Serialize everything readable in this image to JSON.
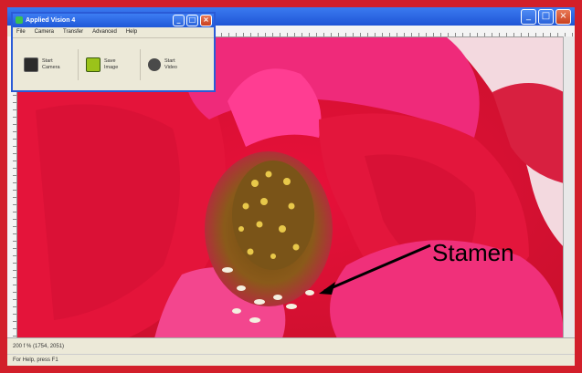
{
  "image_window": {
    "minimize": "_",
    "maximize": "□",
    "close": "×"
  },
  "app_window": {
    "title": "Applied Vision 4",
    "minimize": "_",
    "maximize": "□",
    "close": "×",
    "menu": [
      "File",
      "Camera",
      "Transfer",
      "Advanced",
      "Help"
    ],
    "toolbar": [
      {
        "label_line1": "Start",
        "label_line2": "Camera",
        "icon": "camera-icon",
        "color": "#2b2b2b"
      },
      {
        "label_line1": "Save",
        "label_line2": "Image",
        "icon": "save-image-icon",
        "color": "#9bc31a"
      },
      {
        "label_line1": "Start",
        "label_line2": "Video",
        "icon": "video-icon",
        "color": "#4a4a4a"
      }
    ]
  },
  "annotation": {
    "label": "Stamen"
  },
  "status_bar": {
    "text": "200 f %  (1754, 2051)",
    "text2": "For Help, press F1"
  },
  "colors": {
    "frame": "#d21f2a",
    "petal_red": "#e0203a",
    "petal_pink": "#f0307a",
    "xp_blue": "#1f55d6"
  }
}
